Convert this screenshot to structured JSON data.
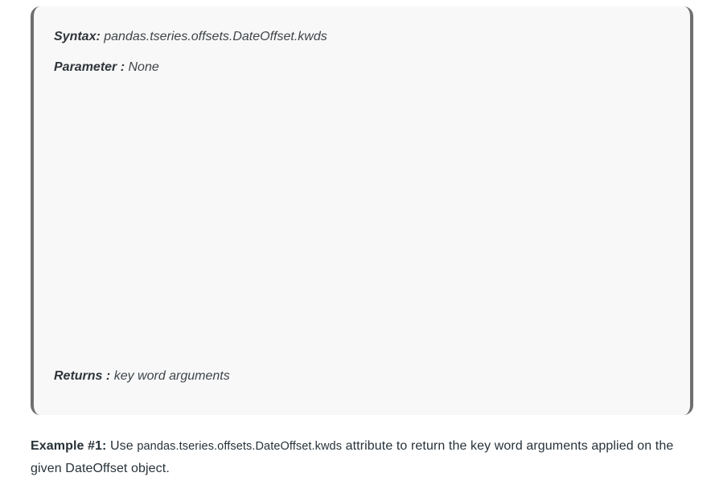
{
  "blockquote": {
    "syntax_label": "Syntax:",
    "syntax_value": "pandas.tseries.offsets.DateOffset.kwds",
    "parameter_label": "Parameter :",
    "parameter_value": "None",
    "returns_label": "Returns :",
    "returns_value": "key word arguments"
  },
  "example": {
    "label": "Example #1:",
    "text_before": "Use",
    "code": "pandas.tseries.offsets.DateOffset.kwds",
    "text_after": "attribute to return the key word arguments applied on the given DateOffset object."
  }
}
